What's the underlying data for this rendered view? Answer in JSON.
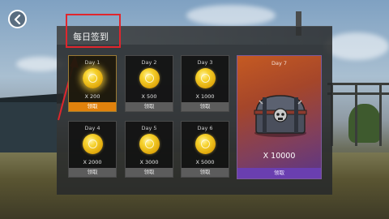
{
  "header": {
    "title": "每日签到"
  },
  "days": [
    {
      "day": "Day 1",
      "amount": "X 200",
      "claim": "领取",
      "active": true
    },
    {
      "day": "Day 2",
      "amount": "X 500",
      "claim": "领取",
      "active": false
    },
    {
      "day": "Day 3",
      "amount": "X 1000",
      "claim": "领取",
      "active": false
    },
    {
      "day": "Day 4",
      "amount": "X 2000",
      "claim": "领取",
      "active": false
    },
    {
      "day": "Day 5",
      "amount": "X 3000",
      "claim": "领取",
      "active": false
    },
    {
      "day": "Day 6",
      "amount": "X 5000",
      "claim": "领取",
      "active": false
    }
  ],
  "day7": {
    "day": "Day 7",
    "amount": "X 10000",
    "claim": "领取"
  },
  "icons": {
    "back": "chevron-left-icon",
    "coin": "gold-coin-icon",
    "chest": "treasure-chest-icon"
  },
  "colors": {
    "accent_orange": "#e1820c",
    "annotation_red": "#e0262d",
    "day7_claim": "#6a3fb0"
  }
}
